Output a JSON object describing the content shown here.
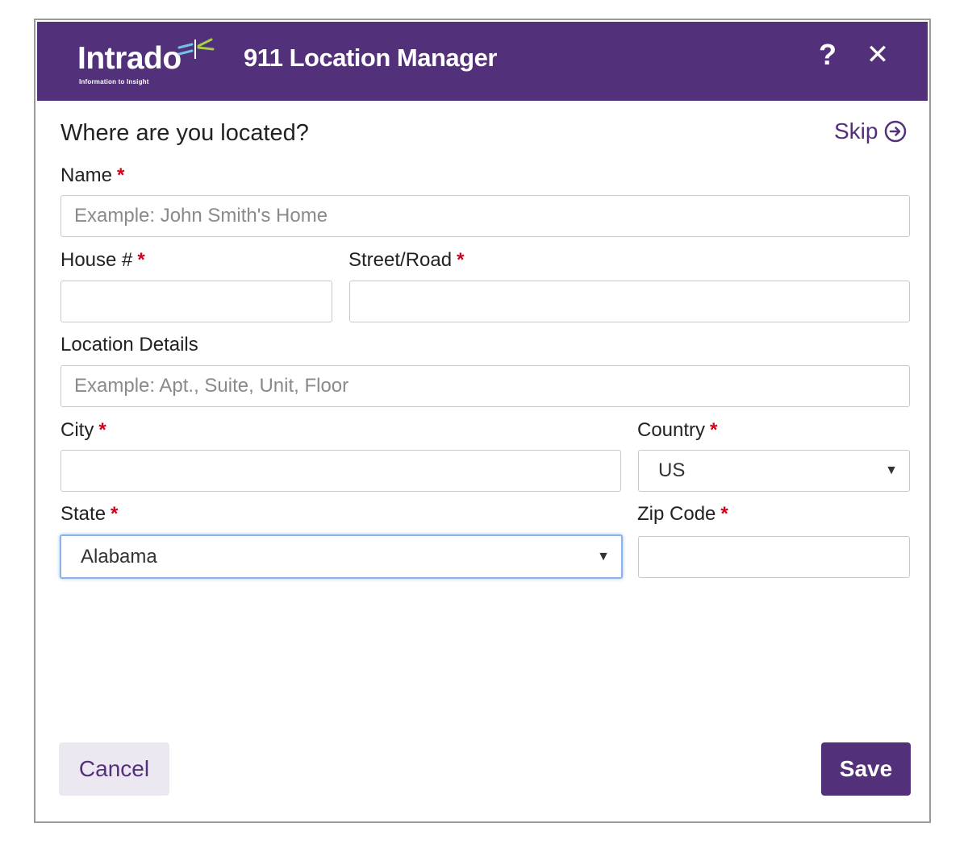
{
  "header": {
    "logo_text": "Intrado",
    "logo_tagline": "Information to Insight",
    "title": "911 Location Manager",
    "help_icon": "question-mark-icon",
    "close_icon": "close-icon",
    "color": "#53307a"
  },
  "form": {
    "heading": "Where are you located?",
    "skip_label": "Skip",
    "skip_icon": "arrow-right-circle-icon",
    "required_marker": "*",
    "fields": {
      "name": {
        "label": "Name",
        "placeholder": "Example: John Smith's Home",
        "value": ""
      },
      "house": {
        "label": "House #",
        "value": ""
      },
      "street": {
        "label": "Street/Road",
        "value": ""
      },
      "details": {
        "label": "Location Details",
        "placeholder": "Example: Apt., Suite, Unit, Floor",
        "value": ""
      },
      "city": {
        "label": "City",
        "value": ""
      },
      "country": {
        "label": "Country",
        "value": "US"
      },
      "state": {
        "label": "State",
        "value": "Alabama"
      },
      "zip": {
        "label": "Zip Code",
        "value": ""
      }
    },
    "dropdown_caret": "▼"
  },
  "footer": {
    "cancel_label": "Cancel",
    "save_label": "Save"
  }
}
